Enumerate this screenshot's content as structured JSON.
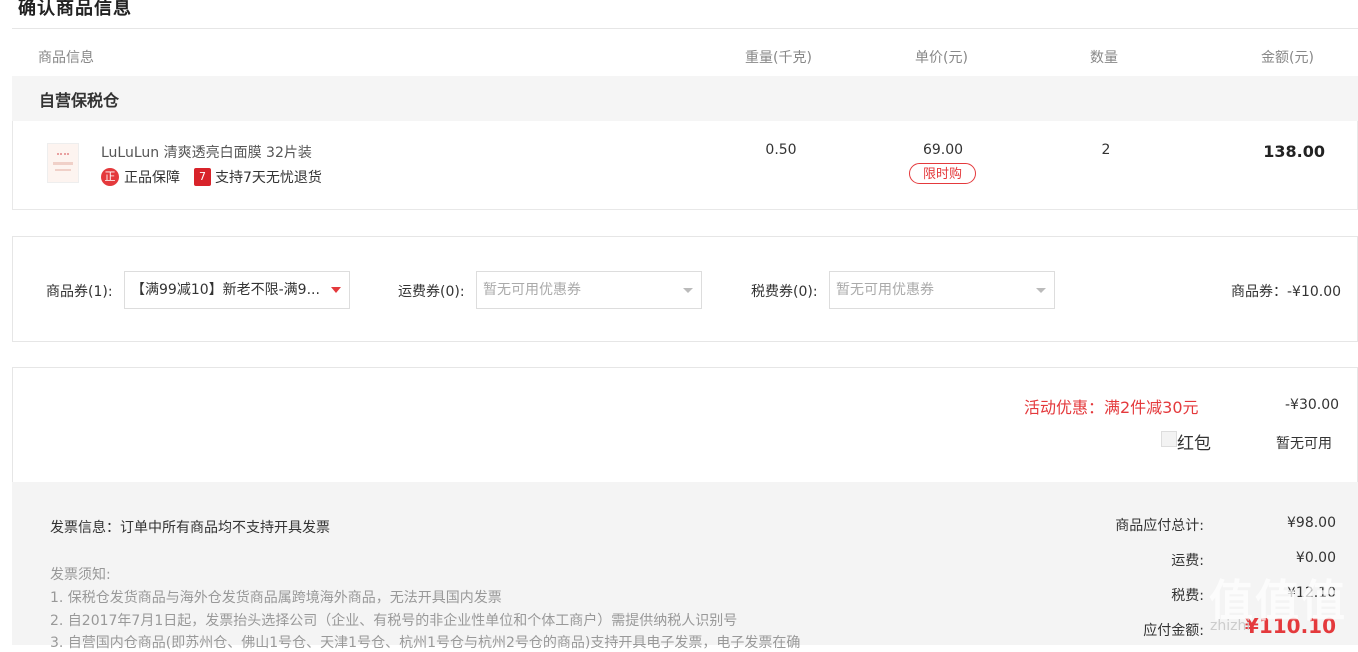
{
  "page_title": "确认商品信息",
  "table_headers": {
    "info": "商品信息",
    "weight": "重量(千克)",
    "price": "单价(元)",
    "qty": "数量",
    "amount": "金额(元)"
  },
  "warehouse": "自营保税仓",
  "product": {
    "name": "LuLuLun 清爽透亮白面膜 32片装",
    "service1_icon": "正",
    "service1": "正品保障",
    "service2_icon": "7",
    "service2": "支持7天无忧退货",
    "weight": "0.50",
    "price": "69.00",
    "limited_tag": "限时购",
    "qty": "2",
    "amount": "138.00"
  },
  "coupons": {
    "goods_label": "商品券(1):",
    "goods_value": "【满99减10】新老不限-满9...",
    "shipping_label": "运费券(0):",
    "shipping_placeholder": "暂无可用优惠券",
    "tax_label": "税费券(0):",
    "tax_placeholder": "暂无可用优惠券",
    "discount_text": "商品券：-¥10.00"
  },
  "promo": {
    "label": "活动优惠：满2件减30元",
    "value": "-¥30.00",
    "hongbao_label": "红包",
    "hongbao_value": "暂无可用"
  },
  "invoice": {
    "info": "发票信息：订单中所有商品均不支持开具发票",
    "notice_title": "发票须知:",
    "notices": [
      "1. 保税仓发货商品与海外仓发货商品属跨境海外商品，无法开具国内发票",
      "2. 自2017年7月1日起，发票抬头选择公司（企业、有税号的非企业性单位和个体工商户）需提供纳税人识别号",
      "3. 自营国内仓商品(即苏州仓、佛山1号仓、天津1号仓、杭州1号仓与杭州2号仓的商品)支持开具电子发票，电子发票在确"
    ]
  },
  "summary": {
    "subtotal_label": "商品应付总计:",
    "subtotal_value": "¥98.00",
    "shipping_label": "运费:",
    "shipping_value": "¥0.00",
    "tax_label": "税费:",
    "tax_value": "¥12.10",
    "total_label": "应付金额:",
    "total_value": "¥110.10"
  },
  "watermark": {
    "main": "值值值",
    "sub": "zhizhi"
  },
  "colors": {
    "accent": "#e4393c",
    "border": "#e6e6e6",
    "panel_bg": "#f4f4f4"
  }
}
